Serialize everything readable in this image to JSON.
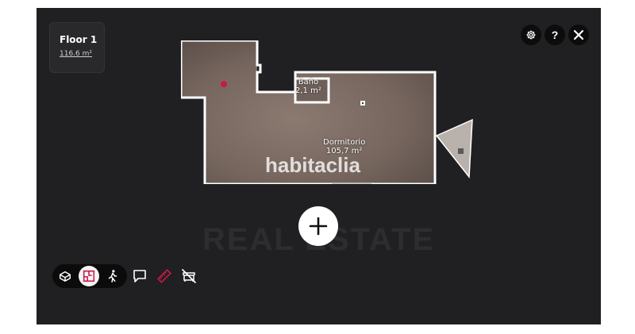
{
  "floor": {
    "title": "Floor 1",
    "area": "116.6 m²"
  },
  "rooms": [
    {
      "name": "Baño",
      "area": "2,1 m²"
    },
    {
      "name": "Dormitorio",
      "area": "105,7 m²"
    }
  ],
  "brand": {
    "name": "habitaclia",
    "watermark": "REAL ESTATE"
  },
  "top_controls": [
    "settings-icon",
    "help-icon",
    "close-icon"
  ],
  "help_glyph": "?",
  "view_modes": [
    {
      "name": "dollhouse-view",
      "active": false
    },
    {
      "name": "floorplan-view",
      "active": true
    },
    {
      "name": "walkthrough-view",
      "active": false
    }
  ],
  "tools": [
    "comment-icon",
    "measure-icon",
    "hide-furniture-icon"
  ],
  "colors": {
    "background": "#202022",
    "accent": "#c8194b",
    "wall": "#ffffff"
  }
}
